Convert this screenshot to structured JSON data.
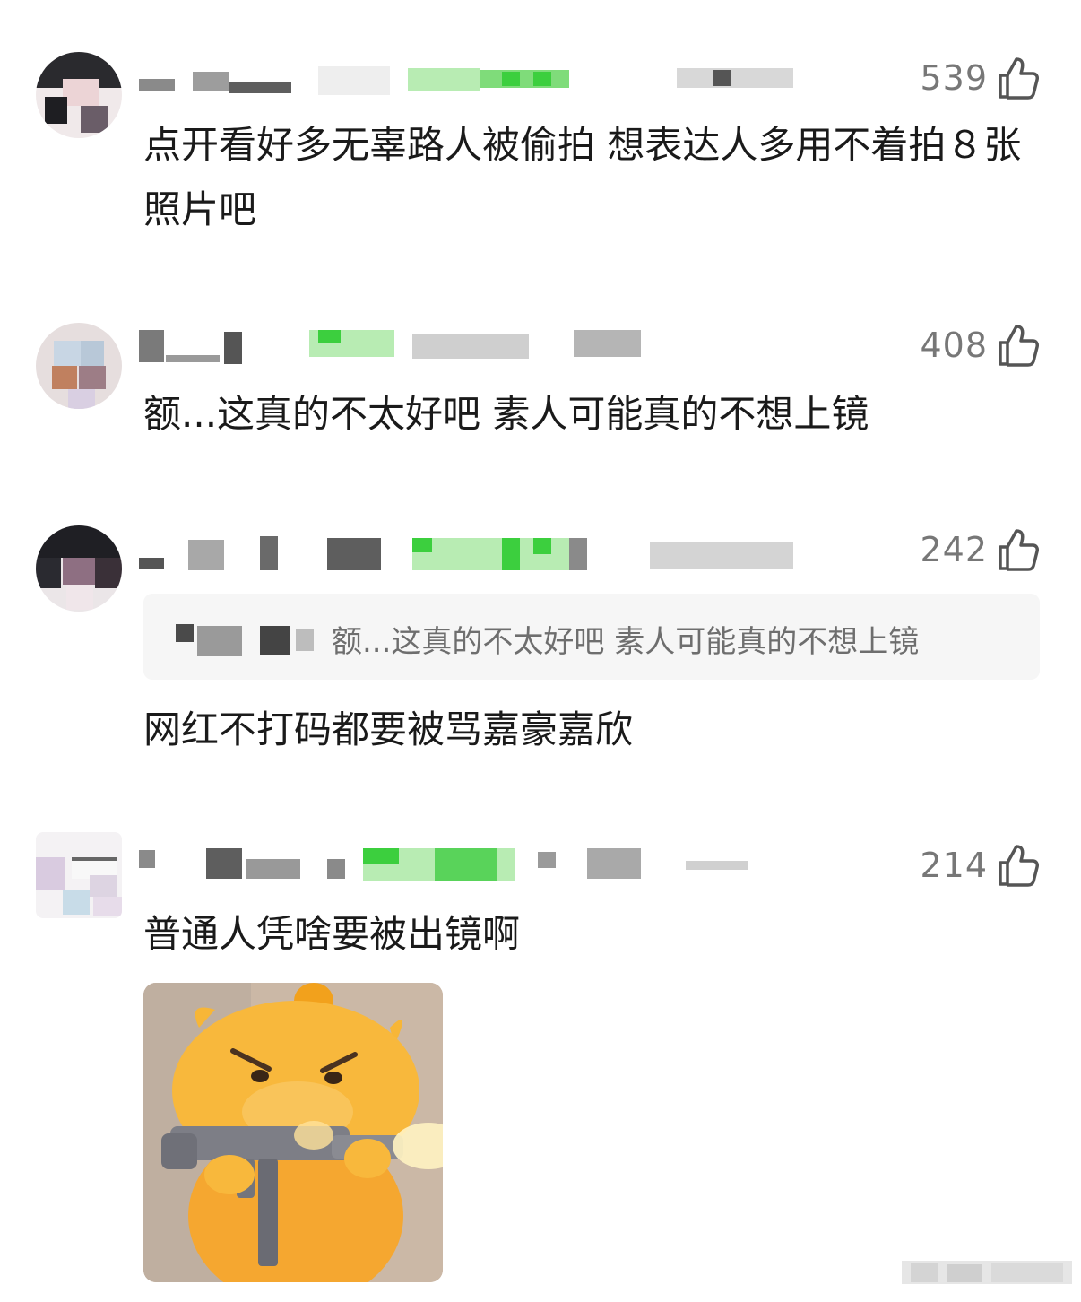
{
  "comments": [
    {
      "likes": "539",
      "text": "点开看好多无辜路人被偷拍 想表达人多用不着拍８张照片吧"
    },
    {
      "likes": "408",
      "text": "额...这真的不太好吧 素人可能真的不想上镜"
    },
    {
      "likes": "242",
      "quote_text": "额...这真的不太好吧 素人可能真的不想上镜",
      "text": "网红不打码都要被骂嘉豪嘉欣"
    },
    {
      "likes": "214",
      "text": "普通人凭啥要被出镜啊",
      "sticker": "angry-yellow-cartoon-character-with-gun"
    }
  ],
  "colors": {
    "like_count": "#777777",
    "body_text": "#1a1a1a",
    "quote_bg": "#f6f6f6",
    "mosaic_green": "#59d35a",
    "mosaic_gray": "#9a9a9a"
  },
  "icons": {
    "like": "thumbs-up-icon"
  }
}
